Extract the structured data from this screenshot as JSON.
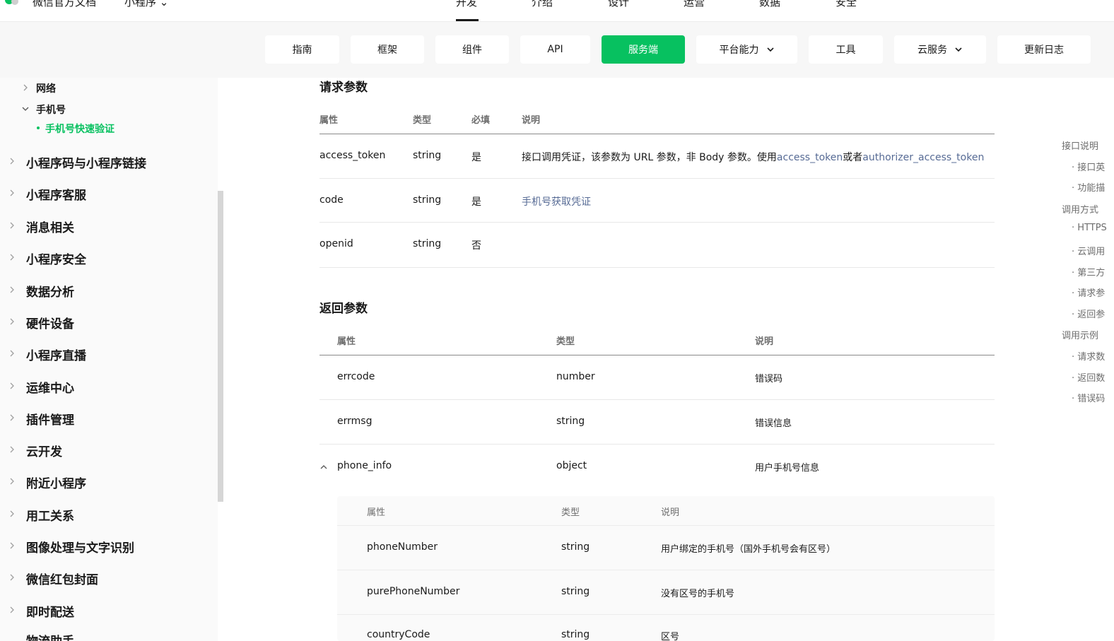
{
  "header": {
    "site_title": "微信官方文档",
    "product": "小程序",
    "nav": [
      "开发",
      "介绍",
      "设计",
      "运营",
      "数据",
      "安全"
    ]
  },
  "tabs": [
    "指南",
    "框架",
    "组件",
    "API",
    "服务端",
    "平台能力",
    "工具",
    "云服务",
    "更新日志"
  ],
  "sidebar": {
    "sub_items": [
      "网络",
      "手机号"
    ],
    "active_item": "手机号快速验证",
    "items": [
      "小程序码与小程序链接",
      "小程序客服",
      "消息相关",
      "小程序安全",
      "数据分析",
      "硬件设备",
      "小程序直播",
      "运维中心",
      "插件管理",
      "云开发",
      "附近小程序",
      "用工关系",
      "图像处理与文字识别",
      "微信红包封面",
      "即时配送",
      "物流助手"
    ]
  },
  "request": {
    "title": "请求参数",
    "headers": [
      "属性",
      "类型",
      "必填",
      "说明"
    ],
    "rows": [
      {
        "name": "access_token",
        "type": "string",
        "required": "是",
        "desc_prefix": "接口调用凭证，该参数为 URL 参数，非 Body 参数。使用",
        "link1": "access_token",
        "desc_mid": "或者",
        "link2": "authorizer_access_token"
      },
      {
        "name": "code",
        "type": "string",
        "required": "是",
        "link": "手机号获取凭证"
      },
      {
        "name": "openid",
        "type": "string",
        "required": "否"
      }
    ]
  },
  "response": {
    "title": "返回参数",
    "headers": [
      "属性",
      "类型",
      "说明"
    ],
    "rows": [
      {
        "name": "errcode",
        "type": "number",
        "desc": "错误码"
      },
      {
        "name": "errmsg",
        "type": "string",
        "desc": "错误信息"
      },
      {
        "name": "phone_info",
        "type": "object",
        "desc": "用户手机号信息"
      }
    ],
    "sub_headers": [
      "属性",
      "类型",
      "说明"
    ],
    "sub_rows": [
      {
        "name": "phoneNumber",
        "type": "string",
        "desc": "用户绑定的手机号（国外手机号会有区号）"
      },
      {
        "name": "purePhoneNumber",
        "type": "string",
        "desc": "没有区号的手机号"
      },
      {
        "name": "countryCode",
        "type": "string",
        "desc": "区号"
      }
    ]
  },
  "toc": {
    "items": [
      {
        "label": "接口说明",
        "level": 1
      },
      {
        "label": "· 接口英",
        "level": 2
      },
      {
        "label": "· 功能描",
        "level": 2
      },
      {
        "label": "调用方式",
        "level": 1
      },
      {
        "label": "· HTTPS",
        "level": 2
      },
      {
        "label": "· 云调用",
        "level": 2
      },
      {
        "label": "· 第三方",
        "level": 2
      },
      {
        "label": "· 请求参",
        "level": 2
      },
      {
        "label": "· 返回参",
        "level": 2
      },
      {
        "label": "调用示例",
        "level": 1
      },
      {
        "label": "· 请求数",
        "level": 2
      },
      {
        "label": "· 返回数",
        "level": 2
      },
      {
        "label": "· 错误码",
        "level": 2
      }
    ]
  }
}
